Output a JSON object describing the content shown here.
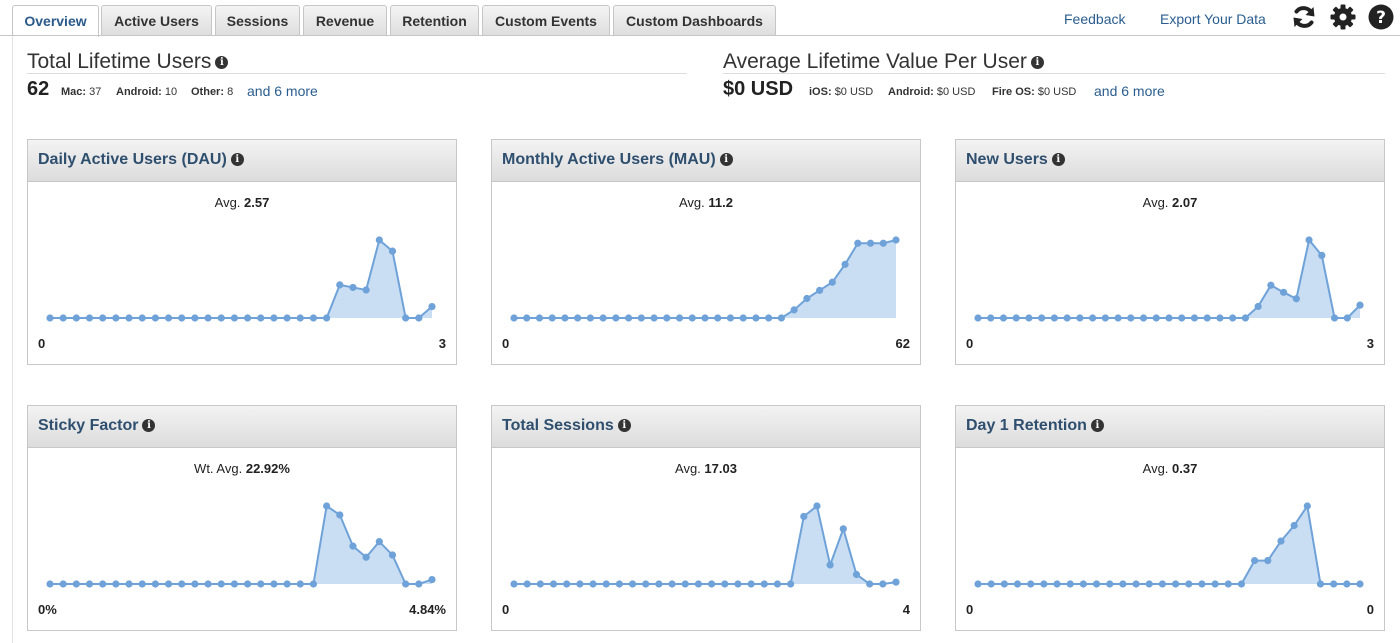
{
  "tabs": [
    {
      "label": "Overview",
      "active": true
    },
    {
      "label": "Active Users",
      "active": false
    },
    {
      "label": "Sessions",
      "active": false
    },
    {
      "label": "Revenue",
      "active": false
    },
    {
      "label": "Retention",
      "active": false
    },
    {
      "label": "Custom Events",
      "active": false
    },
    {
      "label": "Custom Dashboards",
      "active": false
    }
  ],
  "toolbar": {
    "feedback": "Feedback",
    "export": "Export Your Data",
    "icons": [
      "refresh-icon",
      "gear-icon",
      "help-icon"
    ]
  },
  "lifetime_users": {
    "title": "Total Lifetime Users",
    "total": "62",
    "breakdown": [
      {
        "label": "Mac:",
        "value": "37"
      },
      {
        "label": "Android:",
        "value": "10"
      },
      {
        "label": "Other:",
        "value": "8"
      }
    ],
    "more": "and 6 more"
  },
  "lifetime_value": {
    "title": "Average Lifetime Value Per User",
    "total": "$0 USD",
    "breakdown": [
      {
        "label": "iOS:",
        "value": "$0 USD"
      },
      {
        "label": "Android:",
        "value": "$0 USD"
      },
      {
        "label": "Fire OS:",
        "value": "$0 USD"
      }
    ],
    "more": "and 6 more"
  },
  "colors": {
    "line": "#6fa2d8",
    "fill": "#c9def3",
    "title": "#2f4f6f",
    "link": "#2a5d8f"
  },
  "panels": [
    {
      "title": "Daily Active Users (DAU)",
      "avg_label": "Avg.",
      "avg_value": "2.57",
      "min": "0",
      "max": "3",
      "series": [
        0,
        0,
        0,
        0,
        0,
        0,
        0,
        0,
        0,
        0,
        0,
        0,
        0,
        0,
        0,
        0,
        0,
        0,
        0,
        0,
        0,
        0,
        1.04,
        0.96,
        0.88,
        2.45,
        2.1,
        0,
        0,
        0.36
      ]
    },
    {
      "title": "Monthly Active Users (MAU)",
      "avg_label": "Avg.",
      "avg_value": "11.2",
      "min": "0",
      "max": "62",
      "series": [
        0,
        0,
        0,
        0,
        0,
        0,
        0,
        0,
        0,
        0,
        0,
        0,
        0,
        0,
        0,
        0,
        0,
        0,
        0,
        0,
        0,
        0,
        5,
        12,
        17,
        22,
        33,
        46,
        46,
        46,
        48
      ]
    },
    {
      "title": "New Users",
      "avg_label": "Avg.",
      "avg_value": "2.07",
      "min": "0",
      "max": "3",
      "series": [
        0,
        0,
        0,
        0,
        0,
        0,
        0,
        0,
        0,
        0,
        0,
        0,
        0,
        0,
        0,
        0,
        0,
        0,
        0,
        0,
        0,
        0,
        0.36,
        1.02,
        0.8,
        0.6,
        2.43,
        1.95,
        0,
        0,
        0.4
      ]
    },
    {
      "title": "Sticky Factor",
      "avg_label": "Wt. Avg.",
      "avg_value": "22.92%",
      "min": "0%",
      "max": "4.84%",
      "series": [
        0,
        0,
        0,
        0,
        0,
        0,
        0,
        0,
        0,
        0,
        0,
        0,
        0,
        0,
        0,
        0,
        0,
        0,
        0,
        0,
        0,
        3.5,
        3.1,
        1.7,
        1.2,
        1.9,
        1.3,
        0,
        0,
        0.2
      ]
    },
    {
      "title": "Total Sessions",
      "avg_label": "Avg.",
      "avg_value": "17.03",
      "min": "0",
      "max": "4",
      "series": [
        0,
        0,
        0,
        0,
        0,
        0,
        0,
        0,
        0,
        0,
        0,
        0,
        0,
        0,
        0,
        0,
        0,
        0,
        0,
        0,
        0,
        0,
        3.55,
        4.1,
        1.0,
        2.9,
        0.5,
        0,
        0,
        0.1
      ]
    },
    {
      "title": "Day 1 Retention",
      "avg_label": "Avg.",
      "avg_value": "0.37",
      "min": "0",
      "max": "0",
      "series": [
        0,
        0,
        0,
        0,
        0,
        0,
        0,
        0,
        0,
        0,
        0,
        0,
        0,
        0,
        0,
        0,
        0,
        0,
        0,
        0,
        0,
        0.3,
        0.3,
        0.55,
        0.75,
        1.0,
        0,
        0,
        0,
        0
      ]
    }
  ]
}
